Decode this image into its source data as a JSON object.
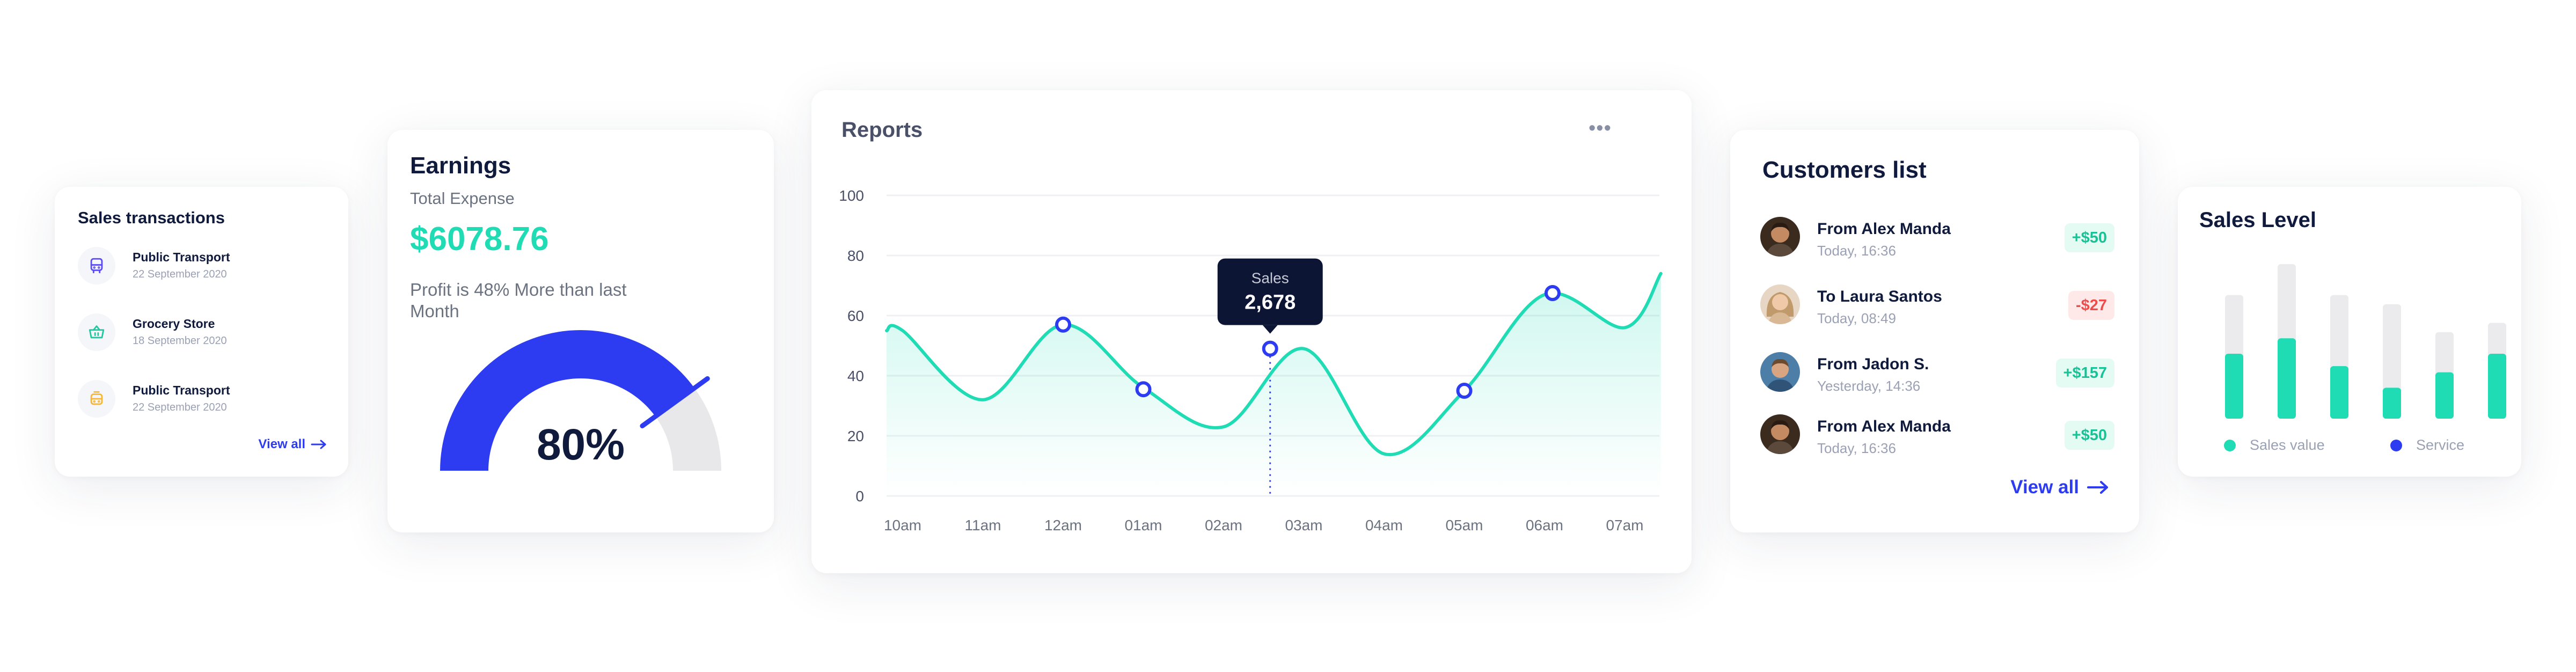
{
  "sales_transactions": {
    "title": "Sales transactions",
    "items": [
      {
        "name": "Public Transport",
        "date": "22 September 2020",
        "icon": "bus-icon",
        "color": "#5b4cf5"
      },
      {
        "name": "Grocery Store",
        "date": "18 September 2020",
        "icon": "basket-icon",
        "color": "#1fc9a0"
      },
      {
        "name": "Public Transport",
        "date": "22 September 2020",
        "icon": "bus-icon",
        "color": "#f7b733"
      }
    ],
    "view_all": "View all"
  },
  "earnings": {
    "title": "Earnings",
    "subtitle": "Total Expense",
    "amount": "$6078.76",
    "note": "Profit is 48% More than last Month",
    "gauge_percent": "80%",
    "gauge_value": 0.8,
    "colors": {
      "fill": "#2d3cf0",
      "track": "#e8e8ea",
      "amount": "#1fdcb4"
    }
  },
  "reports": {
    "title": "Reports",
    "menu_icon": "more-horizontal-icon",
    "tooltip": {
      "label": "Sales",
      "value": "2,678"
    }
  },
  "chart_data": {
    "type": "line",
    "title": "Reports",
    "categories": [
      "10am",
      "11am",
      "12am",
      "01am",
      "02am",
      "03am",
      "04am",
      "05am",
      "06am",
      "07am"
    ],
    "y_ticks": [
      "0",
      "20",
      "40",
      "60",
      "80",
      "100"
    ],
    "ylim": [
      0,
      100
    ],
    "series": [
      {
        "x": [
          0,
          1,
          2,
          3,
          4,
          5,
          6,
          7,
          8,
          9,
          9.45
        ],
        "values": [
          55,
          32,
          57,
          36,
          23,
          49,
          14,
          35,
          67,
          56,
          74
        ]
      }
    ],
    "markers": [
      {
        "x": 2.0,
        "y": 57
      },
      {
        "x": 3.0,
        "y": 35.5
      },
      {
        "x": 4.58,
        "y": 49
      },
      {
        "x": 7.0,
        "y": 35
      },
      {
        "x": 8.1,
        "y": 67.5
      }
    ],
    "highlight": {
      "x": 4.58,
      "y": 49,
      "label": "Sales",
      "value": "2,678"
    },
    "colors": {
      "line": "#1fdcb4",
      "marker": "#2d3cf0",
      "grid": "#eef0f4"
    },
    "grid": true
  },
  "customers": {
    "title": "Customers list",
    "items": [
      {
        "name": "From Alex Manda",
        "time": "Today, 16:36",
        "amount": "+$50",
        "positive": true
      },
      {
        "name": "To Laura Santos",
        "time": "Today, 08:49",
        "amount": "-$27",
        "positive": false
      },
      {
        "name": "From Jadon S.",
        "time": "Yesterday, 14:36",
        "amount": "+$157",
        "positive": true
      },
      {
        "name": "From Alex Manda",
        "time": "Today, 16:36",
        "amount": "+$50",
        "positive": true
      }
    ],
    "view_all": "View all"
  },
  "sales_level": {
    "title": "Sales Level",
    "legend": [
      {
        "label": "Sales value",
        "color": "#1fdcb4"
      },
      {
        "label": "Service",
        "color": "#2d3cf0"
      }
    ],
    "bars": [
      {
        "total": 0.8,
        "value": 0.42
      },
      {
        "total": 1.0,
        "value": 0.52
      },
      {
        "total": 0.8,
        "value": 0.34
      },
      {
        "total": 0.74,
        "value": 0.2
      },
      {
        "total": 0.56,
        "value": 0.3
      },
      {
        "total": 0.62,
        "value": 0.42
      }
    ],
    "colors": {
      "track": "#ebebed",
      "value": "#1fdcb4"
    }
  }
}
